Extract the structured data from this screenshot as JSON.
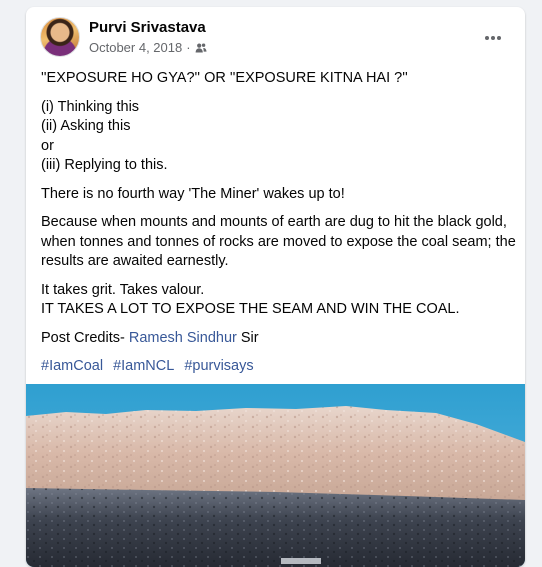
{
  "post": {
    "author": "Purvi Srivastava",
    "date": "October 4, 2018",
    "separator": "·",
    "audience_icon": "friends-icon",
    "more_icon": "more-horizontal-icon",
    "paragraphs": {
      "headline": "''EXPOSURE  HO  GYA?''   OR   ''EXPOSURE  KITNA HAI ?''",
      "line1": "(i) Thinking this",
      "line2": "(ii) Asking this",
      "line3": "or",
      "line4": "(iii) Replying to this.",
      "p2": "There is no fourth way 'The Miner' wakes up to!",
      "p3": "Because when mounts and mounts of earth are dug to hit the black gold, when tonnes and tonnes of rocks are moved to expose the coal seam; the results are awaited earnestly.",
      "p4a": "It takes grit. Takes valour.",
      "p4b": "IT TAKES A LOT TO EXPOSE THE SEAM AND WIN THE COAL.",
      "credits_prefix": "Post Credits-",
      "credits_name": "Ramesh Sindhur",
      "credits_suffix": "Sir"
    },
    "hashtags": [
      "#IamCoal",
      "#IamNCL",
      "#purvisays"
    ]
  },
  "colors": {
    "link": "#385898",
    "meta": "#65676b",
    "background": "#f0f2f5"
  }
}
